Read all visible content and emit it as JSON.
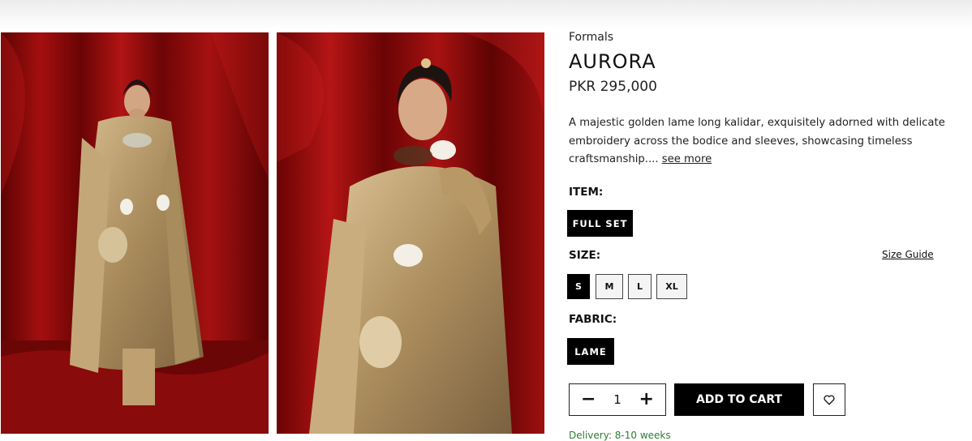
{
  "product": {
    "category": "Formals",
    "title": "AURORA",
    "price": "PKR 295,000",
    "description": "A majestic golden lame long kalidar, exquisitely adorned with delicate embroidery across the bodice and sleeves, showcasing timeless craftsmanship....",
    "see_more": "see more"
  },
  "options": {
    "item_label": "ITEM:",
    "item_value": "FULL SET",
    "size_label": "SIZE:",
    "size_guide": "Size Guide",
    "sizes": [
      "S",
      "M",
      "L",
      "XL"
    ],
    "selected_size": "S",
    "fabric_label": "FABRIC:",
    "fabric_value": "LAME"
  },
  "cart": {
    "quantity": "1",
    "minus": "−",
    "plus": "+",
    "add_to_cart": "ADD TO CART"
  },
  "delivery": "Delivery: 8-10 weeks",
  "icons": [
    "minus-icon",
    "plus-icon",
    "heart-icon"
  ],
  "colors": {
    "curtain_red": "#8b0c0c",
    "gold": "#b89a6a",
    "black": "#000000"
  }
}
